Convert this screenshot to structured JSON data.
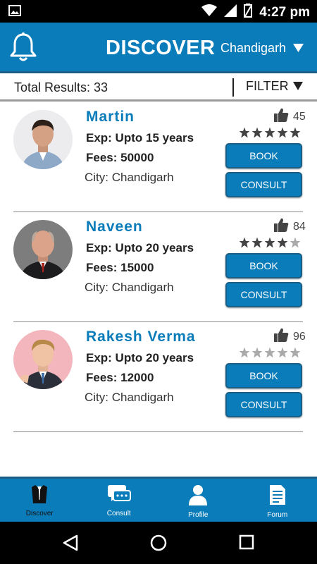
{
  "status_bar": {
    "time": "4:27 pm"
  },
  "header": {
    "title": "DISCOVER",
    "city": "Chandigarh"
  },
  "results": {
    "total_label": "Total Results: 33",
    "filter_label": "FILTER"
  },
  "doctors": [
    {
      "name": "Martin",
      "exp": "Exp: Upto 15 years",
      "fees": "Fees: 50000",
      "city": "City: Chandigarh",
      "likes": "45",
      "rating": 5,
      "book_label": "BOOK",
      "consult_label": "CONSULT"
    },
    {
      "name": "Naveen",
      "exp": "Exp: Upto 20 years",
      "fees": "Fees: 15000",
      "city": "City: Chandigarh",
      "likes": "84",
      "rating": 4,
      "book_label": "BOOK",
      "consult_label": "CONSULT"
    },
    {
      "name": "Rakesh Verma",
      "exp": "Exp: Upto 20 years",
      "fees": "Fees: 12000",
      "city": "City: Chandigarh",
      "likes": "96",
      "rating": 0,
      "book_label": "BOOK",
      "consult_label": "CONSULT"
    }
  ],
  "tabs": [
    {
      "label": "Discover",
      "icon": "lawyer-coat-icon",
      "active": true
    },
    {
      "label": "Consult",
      "icon": "chat-icon",
      "active": false
    },
    {
      "label": "Profile",
      "icon": "person-icon",
      "active": false
    },
    {
      "label": "Forum",
      "icon": "document-icon",
      "active": false
    }
  ],
  "colors": {
    "primary": "#0B7CBA",
    "primary_dark": "#1B5F87",
    "star_filled": "#444444",
    "star_empty": "#AAAAAA"
  }
}
